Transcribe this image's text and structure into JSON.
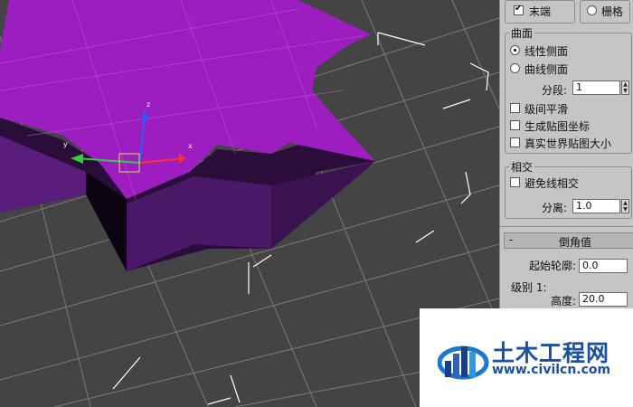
{
  "viewport": {
    "axis_labels": {
      "z": "z",
      "x": "x",
      "y": "y"
    },
    "colors": {
      "background": "#444444",
      "star_top": "#9c1ec1",
      "star_side": "#3a1250",
      "grid": "#8a8a8a",
      "bbox": "#ffffff"
    }
  },
  "panel": {
    "top_options": [
      {
        "label": "末端",
        "checked": true
      },
      {
        "label": "栅格",
        "checked": false
      }
    ],
    "surface": {
      "title": "曲面",
      "radio_linear": "线性侧面",
      "radio_curved": "曲线侧面",
      "segments_label": "分段:",
      "segments_value": "1",
      "smooth_across_levels": "级间平滑",
      "gen_mapping": "生成贴图坐标",
      "real_world_map": "真实世界贴图大小"
    },
    "intersections": {
      "title": "相交",
      "avoid_self_intersect": "避免线相交",
      "separation_label": "分离:",
      "separation_value": "1.0"
    },
    "bevel_values": {
      "rollout_minus": "-",
      "rollout_title": "倒角值",
      "start_outline_label": "起始轮廓:",
      "start_outline_value": "0.0",
      "level1_label": "级别 1:",
      "height_label": "高度:",
      "height_value": "20.0"
    }
  },
  "watermark": {
    "name": "土木工程网",
    "url": "www.civilcn.com"
  }
}
